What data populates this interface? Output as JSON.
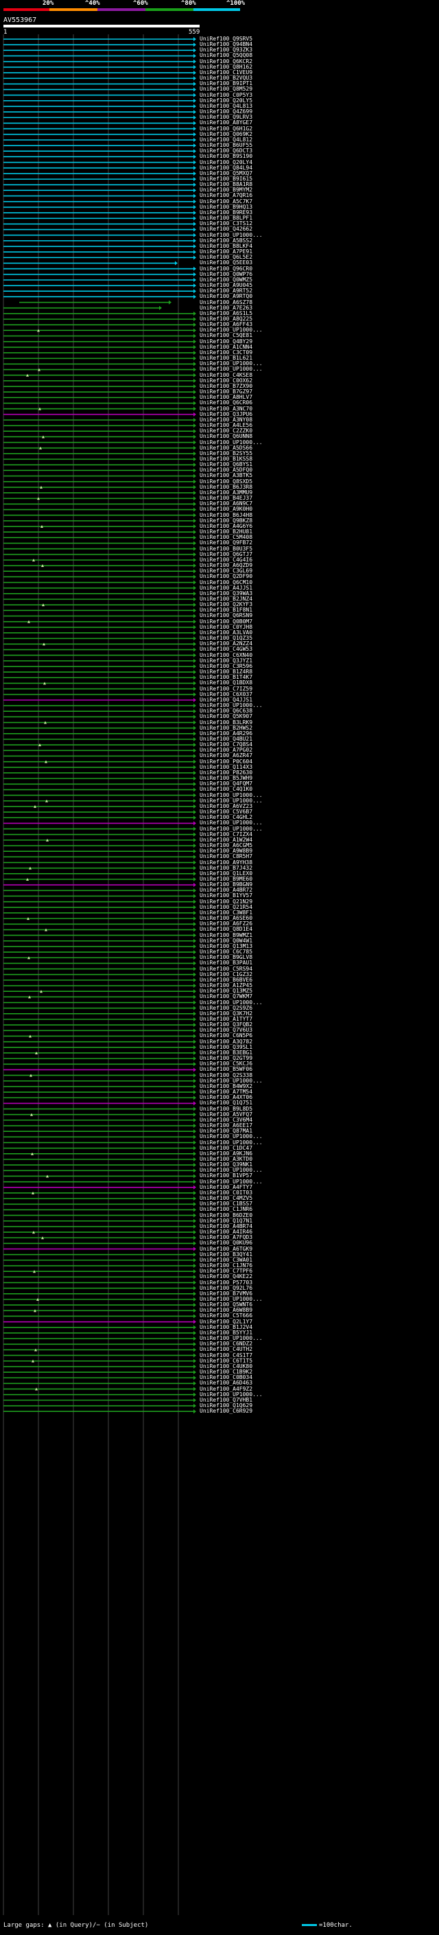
{
  "scale": {
    "labels": [
      "20%",
      "^40%",
      "^60%",
      "^80%",
      "^100%"
    ],
    "colors": [
      "#e60012",
      "#ff8c00",
      "#8c1aa0",
      "#1aa01a",
      "#00c8e6"
    ]
  },
  "query": {
    "name": "AV553967",
    "start": "1",
    "end": "559"
  },
  "legend": {
    "gaps_text": "Large gaps: ▲ (in Query)/− (in Subject)",
    "scale_text": "=100char."
  },
  "chart_data": {
    "type": "alignment-overview",
    "query_length": 559,
    "colors": {
      "cyan": "#00c8e6",
      "magenta": "#b400b4",
      "green": "#1e9e1e"
    },
    "hits": [
      "UniRef100_Q9SRV5",
      "UniRef100_Q94BN4",
      "UniRef100_Q93ZK3",
      "UniRef100_Q5QQ08",
      "UniRef100_Q6KCR2",
      "UniRef100_Q8H162",
      "UniRef100_C1VEU9",
      "UniRef100_B2VQU3",
      "UniRef100_B9IPT1",
      "UniRef100_Q8M529",
      "UniRef100_C0P5Y3",
      "UniRef100_Q20LY5",
      "UniRef100_Q4L813",
      "UniRef100_Q4Z699",
      "UniRef100_Q9LRV3",
      "UniRef100_A8YGE7",
      "UniRef100_Q6H1G2",
      "UniRef100_Q069K2",
      "UniRef100_Q4L812",
      "UniRef100_B6UF55",
      "UniRef100_Q6DCT3",
      "UniRef100_B9S190",
      "UniRef100_Q20LY4",
      "UniRef100_Q84L94",
      "UniRef100_Q5MXQ7",
      "UniRef100_B9I615",
      "UniRef100_B8A1R8",
      "UniRef100_B9MYM2",
      "UniRef100_A7QR16",
      "UniRef100_A5C7K7",
      "UniRef100_B9HQ13",
      "UniRef100_B9RE93",
      "UniRef100_B8LPF1",
      "UniRef100_C3TS12",
      "UniRef100_Q42662",
      "UniRef100_UP1000...",
      "UniRef100_A5BSS2",
      "UniRef100_B8LKF4",
      "UniRef100_A7PE91",
      "UniRef100_Q6L5E2",
      "UniRef100_Q5EE03",
      "UniRef100_Q96CR0",
      "UniRef100_Q0WP76",
      "UniRef100_Q0WMZ5",
      "UniRef100_A9U045",
      "UniRef100_A9RT52",
      "UniRef100_A9RTQ0",
      "UniRef100_A6SZ78",
      "UniRef100_A7E263",
      "UniRef100_A6S1L5",
      "UniRef100_A8Q225",
      "UniRef100_A6FF43",
      "UniRef100_UP1000...",
      "UniRef100_C5QE81",
      "UniRef100_Q4BY29",
      "UniRef100_A1CNN4",
      "UniRef100_C3CT09",
      "UniRef100_B1L621",
      "UniRef100_UP1000...",
      "UniRef100_UP1000...",
      "UniRef100_C4KSE8",
      "UniRef100_C0OX62",
      "UniRef100_B7ZX90",
      "UniRef100_B7GZ97",
      "UniRef100_A8HLV7",
      "UniRef100_Q6CR06",
      "UniRef100_A3NC70",
      "UniRef100_Q3JPU6",
      "UniRef100_A3NY08",
      "UniRef100_A4LE56",
      "UniRef100_C2ZZK0",
      "UniRef100_Q6UNN8",
      "UniRef100_UP1000...",
      "UniRef100_A5DS66",
      "UniRef100_B2SY55",
      "UniRef100_B1KSS8",
      "UniRef100_Q6BYS1",
      "UniRef100_A5DFQ0",
      "UniRef100_A3BTK5",
      "UniRef100_Q8SXD5",
      "UniRef100_B6J3R8",
      "UniRef100_A3MMU9",
      "UniRef100_B4EJ37",
      "UniRef100_A6N9C7",
      "UniRef100_A9K0H0",
      "UniRef100_B6J4H8",
      "UniRef100_Q9BKZ8",
      "UniRef100_A4G6Y6",
      "UniRef100_B2HU81",
      "UniRef100_C5M408",
      "UniRef100_Q9FB72",
      "UniRef100_B0U3F5",
      "UniRef100_Q6GTJ7",
      "UniRef100_C4G4I6",
      "UniRef100_A6QZD9",
      "UniRef100_C3GL69",
      "UniRef100_Q2DF90",
      "UniRef100_Q6CM10",
      "UniRef100_A4JJS1",
      "UniRef100_Q39WA3",
      "UniRef100_B2JNZ4",
      "UniRef100_Q2KYF3",
      "UniRef100_B1F8N1",
      "UniRef100_Q6RSN9",
      "UniRef100_Q0B0M7",
      "UniRef100_C0YJH8",
      "UniRef100_A3LVA0",
      "UniRef100_Q1QZ35",
      "UniRef100_A2NZZ4",
      "UniRef100_C4GW53",
      "UniRef100_C6XN40",
      "UniRef100_Q3JYZ1",
      "UniRef100_C3R596",
      "UniRef100_B1Z4R8",
      "UniRef100_B1T4K7",
      "UniRef100_Q1BDX8",
      "UniRef100_C7IZ59",
      "UniRef100_C6X037",
      "UniRef100_Q4JJS1",
      "UniRef100_UP1000...",
      "UniRef100_Q6C638",
      "UniRef100_Q5K907",
      "UniRef100_B3LRK9",
      "UniRef100_B2HWS2",
      "UniRef100_A4R296",
      "UniRef100_Q4BU21",
      "UniRef100_C7Q8S4",
      "UniRef100_A7PG02",
      "UniRef100_A6ZR47",
      "UniRef100_P0C604",
      "UniRef100_Q114X3",
      "UniRef100_P82630",
      "UniRef100_B5JWH9",
      "UniRef100_Q4FQM7",
      "UniRef100_C4Q1K0",
      "UniRef100_UP1000...",
      "UniRef100_UP1000...",
      "UniRef100_A6VZ23",
      "UniRef100_C5V6B7",
      "UniRef100_C4GHL2",
      "UniRef100_UP1000...",
      "UniRef100_UP1000...",
      "UniRef100_C7IZX4",
      "UniRef100_A1W2W4",
      "UniRef100_A6CGM5",
      "UniRef100_A9W8B9",
      "UniRef100_C8R5H7",
      "UniRef100_A9YH38",
      "UniRef100_B7J432",
      "UniRef100_Q1LEX0",
      "UniRef100_B9ME60",
      "UniRef100_B9BGN9",
      "UniRef100_A4BR72",
      "UniRef100_B1YV57",
      "UniRef100_Q21N29",
      "UniRef100_Q21R54",
      "UniRef100_C3W8F1",
      "UniRef100_A6SE60",
      "UniRef100_A6FZ26",
      "UniRef100_Q8D1E4",
      "UniRef100_B9WMZ1",
      "UniRef100_Q0W4W1",
      "UniRef100_Q13M13",
      "UniRef100_C6C785",
      "UniRef100_B9GLV8",
      "UniRef100_B3PAU1",
      "UniRef100_C5RS94",
      "UniRef100_C1GZ32",
      "UniRef100_B6BVE6",
      "UniRef100_A1ZP45",
      "UniRef100_Q13MZ5",
      "UniRef100_Q7WKM7",
      "UniRef100_UP1000...",
      "UniRef100_Q2S9Z6",
      "UniRef100_Q3K7H2",
      "UniRef100_A1TYT7",
      "UniRef100_Q3FQB2",
      "UniRef100_Q7V6U3",
      "UniRef100_C6N5P6",
      "UniRef100_A3Q782",
      "UniRef100_Q39SL1",
      "UniRef100_B3EBG1",
      "UniRef100_Q2GT99",
      "UniRef100_C5KCJ6",
      "UniRef100_B5WF06",
      "UniRef100_Q2S338",
      "UniRef100_UP1000...",
      "UniRef100_B4W9X2",
      "UniRef100_A7TM54",
      "UniRef100_A4XT06",
      "UniRef100_Q1Q751",
      "UniRef100_B9L8D5",
      "UniRef100_A5VFQ7",
      "UniRef100_C3V6M4",
      "UniRef100_A6EE17",
      "UniRef100_Q87MA1",
      "UniRef100_UP1000...",
      "UniRef100_UP1000...",
      "UniRef100_C1DC47",
      "UniRef100_A9KJN6",
      "UniRef100_A3KTD0",
      "UniRef100_Q39NK1",
      "UniRef100_UP1000...",
      "UniRef100_B1VP57",
      "UniRef100_UP1000...",
      "UniRef100_A4FTY7",
      "UniRef100_C0IT03",
      "UniRef100_C4MZV5",
      "UniRef100_C1BSS7",
      "UniRef100_C1JNR6",
      "UniRef100_B6DZE0",
      "UniRef100_Q1Q7N1",
      "UniRef100_A4BR74",
      "UniRef100_A4IR46",
      "UniRef100_A7FQD3",
      "UniRef100_Q0KU96",
      "UniRef100_A6TGK9",
      "UniRef100_B3QY41",
      "UniRef100_C3WA01",
      "UniRef100_C1JN76",
      "UniRef100_C7TPF6",
      "UniRef100_Q4KE22",
      "UniRef100_P57703",
      "UniRef100_Q92L76",
      "UniRef100_B7VMV6",
      "UniRef100_UP1000...",
      "UniRef100_Q5WNT6",
      "UniRef100_A6W8B9",
      "UniRef100_C5T666",
      "UniRef100_Q2L1Y7",
      "UniRef100_B1J2V4",
      "UniRef100_B5YYJ1",
      "UniRef100_UP1000...",
      "UniRef100_C6NDZ2",
      "UniRef100_C4UTH2",
      "UniRef100_C4S1T7",
      "UniRef100_C6T1T5",
      "UniRef100_C4UK80",
      "UniRef100_C1B9K2",
      "UniRef100_C0B034",
      "UniRef100_A6D463",
      "UniRef100_A4F9Z2",
      "UniRef100_UP1000...",
      "UniRef100_Q7VHB1",
      "UniRef100_Q1Q629",
      "UniRef100_C6R929"
    ],
    "pattern": {
      "cyan_rows": 47,
      "magenta_rows": [
        67,
        118,
        140,
        151,
        184,
        190,
        205,
        216,
        229,
        250,
        262,
        272,
        283,
        296,
        315,
        324,
        330,
        331
      ],
      "default": "green"
    }
  }
}
